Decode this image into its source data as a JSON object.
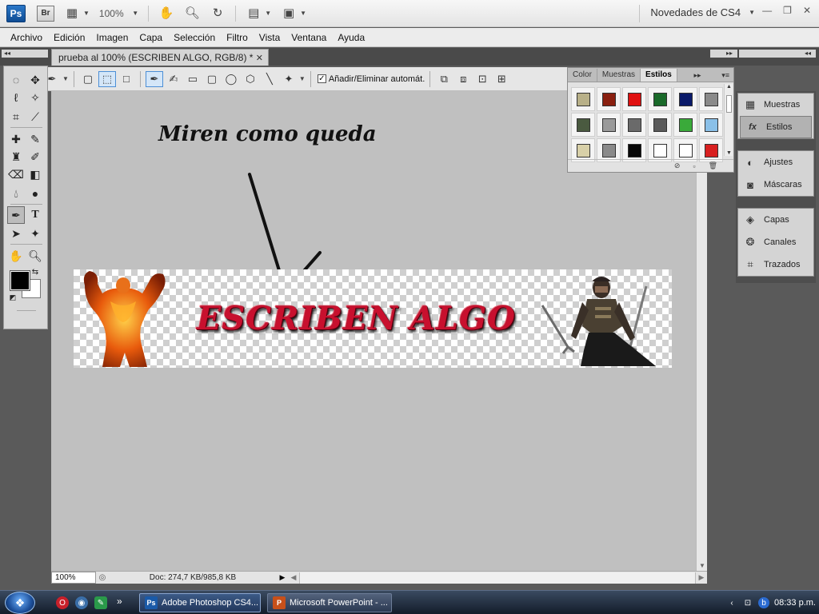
{
  "app": {
    "logo": "Ps",
    "bridge_logo": "Br",
    "zoom_dropdown": "100%",
    "workspace": "Novedades de CS4"
  },
  "menu": [
    "Archivo",
    "Edición",
    "Imagen",
    "Capa",
    "Selección",
    "Filtro",
    "Vista",
    "Ventana",
    "Ayuda"
  ],
  "document": {
    "tab_title": "prueba al 100% (ESCRIBEN ALGO, RGB/8) *",
    "handwritten_note": "Miren como queda",
    "banner_text": "ESCRIBEN ALGO"
  },
  "options_bar": {
    "auto_add_delete_label": "Añadir/Eliminar automát.",
    "auto_add_delete_checked": true
  },
  "styles_panel": {
    "tabs": [
      "Color",
      "Muestras",
      "Estilos"
    ],
    "active_tab": "Estilos",
    "swatches": [
      "#b8b088",
      "#8a2010",
      "#e01010",
      "#1a6a2a",
      "#0a1a6a",
      "#8a8a8a",
      "#4a5a40",
      "#9a9a9a",
      "#6a6a6a",
      "#5a5a5a",
      "#3aaa3a",
      "#8ac0e8",
      "#d8d0a8",
      "#8a8a8a",
      "#080808",
      "#ffffff",
      "#ffffff",
      "#d82020"
    ]
  },
  "dock": {
    "group1": [
      "Muestras",
      "Estilos"
    ],
    "group1_active": "Estilos",
    "group2": [
      "Ajustes",
      "Máscaras"
    ],
    "group3": [
      "Capas",
      "Canales",
      "Trazados"
    ]
  },
  "status": {
    "zoom": "100%",
    "doc_info": "Doc: 274,7 KB/985,8 KB"
  },
  "taskbar": {
    "tasks": [
      "Adobe Photoshop CS4...",
      "Microsoft PowerPoint - ..."
    ],
    "clock": "08:33 p.m."
  }
}
